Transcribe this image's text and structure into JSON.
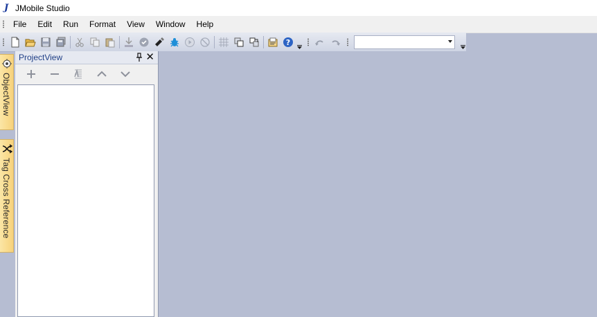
{
  "window": {
    "title": "JMobile Studio",
    "app_icon_glyph": "J"
  },
  "menubar": {
    "items": [
      {
        "label": "File"
      },
      {
        "label": "Edit"
      },
      {
        "label": "Run"
      },
      {
        "label": "Format"
      },
      {
        "label": "View"
      },
      {
        "label": "Window"
      },
      {
        "label": "Help"
      }
    ]
  },
  "toolbar": {
    "buttons": [
      {
        "icon": "new-file-icon"
      },
      {
        "icon": "open-folder-icon"
      },
      {
        "icon": "save-icon"
      },
      {
        "icon": "save-all-icon"
      },
      {
        "icon": "cut-icon"
      },
      {
        "icon": "copy-icon"
      },
      {
        "icon": "paste-icon"
      },
      {
        "icon": "download-icon"
      },
      {
        "icon": "validate-icon"
      },
      {
        "icon": "usb-key-icon"
      },
      {
        "icon": "debug-bug-icon"
      },
      {
        "icon": "run-icon"
      },
      {
        "icon": "stop-icon"
      },
      {
        "icon": "grid-icon"
      },
      {
        "icon": "bring-front-icon"
      },
      {
        "icon": "send-back-icon"
      },
      {
        "icon": "properties-icon"
      },
      {
        "icon": "help-icon"
      },
      {
        "icon": "undo-icon"
      },
      {
        "icon": "redo-icon"
      }
    ],
    "combo_value": ""
  },
  "side_tabs": [
    {
      "label": "ObjectView",
      "icon": "object-view-icon"
    },
    {
      "label": "Tag Cross Reference",
      "icon": "cross-reference-icon"
    }
  ],
  "project_panel": {
    "title": "ProjectView",
    "tools": [
      {
        "icon": "add-icon"
      },
      {
        "icon": "remove-icon"
      },
      {
        "icon": "rename-icon"
      },
      {
        "icon": "move-up-icon"
      },
      {
        "icon": "move-down-icon"
      }
    ]
  },
  "colors": {
    "workspace": "#b6bdd2",
    "toolbar_top": "#e6e9f1",
    "toolbar_bottom": "#cfd5e4",
    "side_tab": "#f7d27b",
    "panel_title": "#1f3f86"
  }
}
